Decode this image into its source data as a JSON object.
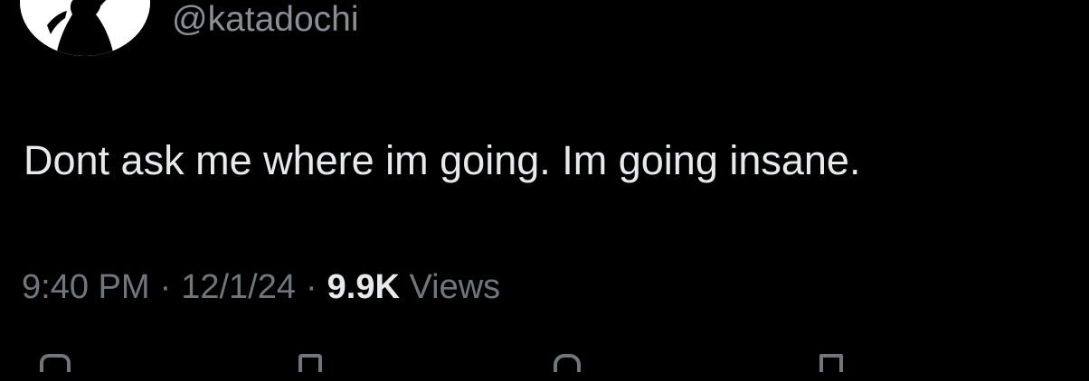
{
  "tweet": {
    "handle": "@katadochi",
    "text": "Dont ask me where im going. Im going insane.",
    "time": "9:40 PM",
    "date": "12/1/24",
    "views_count": "9.9K",
    "views_label": "Views",
    "separator": "·"
  },
  "icons": {
    "avatar": "silhouette-avatar",
    "actions": [
      "reply-icon",
      "repost-icon",
      "like-icon",
      "bookmark-icon"
    ]
  },
  "colors": {
    "background": "#000000",
    "primary_text": "#e7e9ea",
    "secondary_text": "#71767b"
  }
}
